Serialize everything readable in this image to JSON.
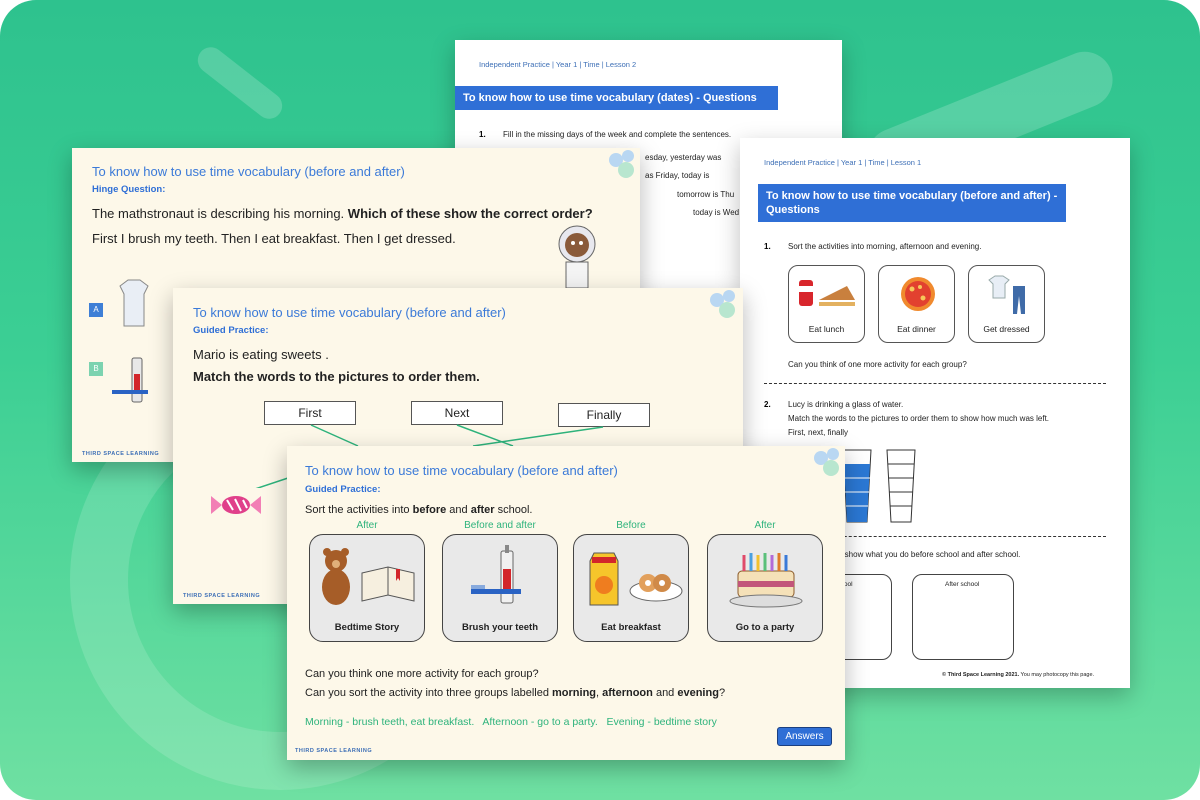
{
  "colors": {
    "accent": "#2f6fd6",
    "green": "#2eb37c",
    "slide_bg": "#fdf8e9"
  },
  "worksheet_dates": {
    "header": "Independent Practice | Year 1 | Time | Lesson 2",
    "title": "To know how to use time vocabulary (dates) - Questions",
    "q1_num": "1.",
    "q1_text": "Fill in the missing days of the week and complete the sentences.",
    "line1": "esday, yesterday was",
    "line2": "as Friday, today is",
    "line3": "tomorrow is Thu",
    "line4": "today is Wed"
  },
  "worksheet_before_after": {
    "header": "Independent Practice | Year 1 | Time | Lesson 1",
    "title": "To know how to use time vocabulary (before and after) - Questions",
    "q1_num": "1.",
    "q1_text": "Sort the activities into morning, afternoon and evening.",
    "cards": [
      "Eat lunch",
      "Eat dinner",
      "Get dressed"
    ],
    "q1_follow": "Can you think of one more activity for each group?",
    "q2_num": "2.",
    "q2_line1": "Lucy is drinking a glass of water.",
    "q2_line2": "Match the words to the pictures to order them to show how much was left.",
    "q2_line3": "First, next, finally",
    "q3_text": "o show what you do before school and after school.",
    "box1": "chool",
    "box2": "After school",
    "footer_bold": "© Third Space Learning 2021.",
    "footer_rest": " You may photocopy this page."
  },
  "slide_hinge": {
    "title": "To know how to use time vocabulary (before and after)",
    "subtitle": "Hinge Question:",
    "line1_plain": "The mathstronaut is describing his morning. ",
    "line1_bold": "Which of these show the correct order?",
    "line2": "First I brush my teeth. Then I eat breakfast. Then I get dressed.",
    "opt_a": "A",
    "opt_b": "B",
    "logo": "THIRD SPACE LEARNING"
  },
  "slide_guided_match": {
    "title": "To know how to use time vocabulary (before and after)",
    "subtitle": "Guided Practice:",
    "line1": "Mario is eating sweets .",
    "line2": "Match the words to the pictures to order them.",
    "boxes": [
      "First",
      "Next",
      "Finally"
    ],
    "logo": "THIRD SPACE LEARNING"
  },
  "slide_guided_sort": {
    "title": "To know how to use time vocabulary (before and after)",
    "subtitle": "Guided Practice:",
    "intro_a": "Sort the activities into ",
    "intro_b": "before",
    "intro_c": " and ",
    "intro_d": "after",
    "intro_e": " school.",
    "groups": [
      "After",
      "Before and after",
      "Before",
      "After"
    ],
    "cards": [
      "Bedtime Story",
      "Brush your teeth",
      "Eat breakfast",
      "Go to a party"
    ],
    "q1": "Can you think one more activity for each group?",
    "q2_a": "Can you sort the activity into three groups labelled ",
    "q2_b": "morning",
    "q2_c": ", ",
    "q2_d": "afternoon",
    "q2_e": " and ",
    "q2_f": "evening",
    "q2_g": "?",
    "answer_text": "Morning - brush teeth, eat breakfast.   Afternoon - go to a party.   Evening - bedtime story",
    "answers_button": "Answers",
    "logo": "THIRD SPACE LEARNING"
  }
}
